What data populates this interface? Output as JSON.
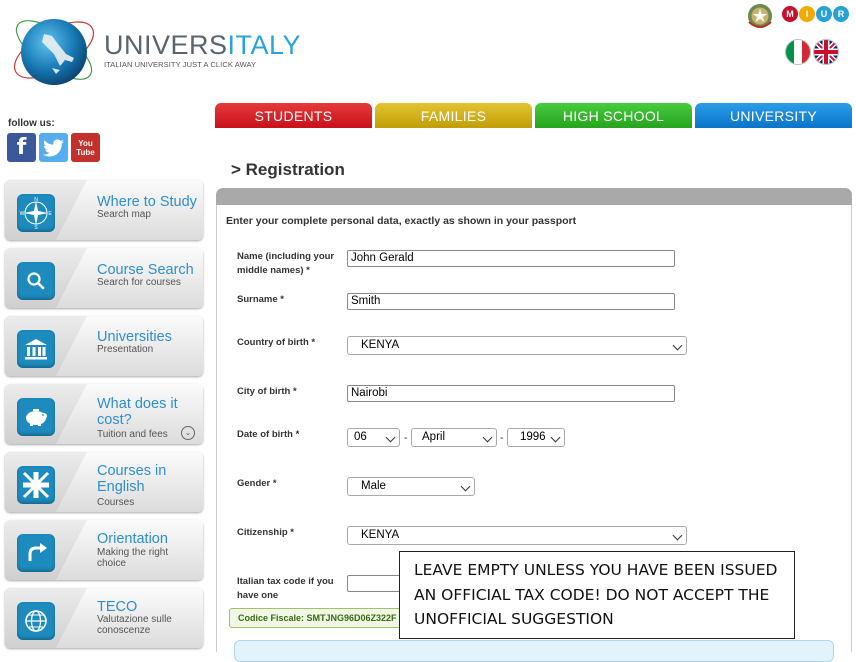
{
  "brand": {
    "name_a": "UNIVERS",
    "name_b": "ITALY",
    "tagline": "ITALIAN UNIVERSITY JUST A CLICK AWAY"
  },
  "miur_letters": [
    "M",
    "I",
    "U",
    "R"
  ],
  "follow_us": "follow us:",
  "social": {
    "youtube_top": "You",
    "youtube_bottom": "Tube"
  },
  "nav": {
    "students": "STUDENTS",
    "families": "FAMILIES",
    "high_school": "HIGH SCHOOL",
    "university": "UNIVERSITY"
  },
  "sidebar": [
    {
      "title": "Where to Study",
      "subtitle": "Search map",
      "icon": "compass-icon"
    },
    {
      "title": "Course Search",
      "subtitle": "Search for courses",
      "icon": "magnifier-icon"
    },
    {
      "title": "Universities",
      "subtitle": "Presentation",
      "icon": "institution-icon"
    },
    {
      "title": "What does it cost?",
      "subtitle": "Tuition and fees",
      "icon": "piggy-bank-icon"
    },
    {
      "title": "Courses in English",
      "subtitle": "Courses",
      "icon": "union-jack-icon"
    },
    {
      "title": "Orientation",
      "subtitle": "Making the right choice",
      "icon": "arrow-turn-icon"
    },
    {
      "title": "TECO",
      "subtitle": "Valutazione sulle conoscenze",
      "icon": "globe-icon"
    }
  ],
  "page_title": "> Registration",
  "form": {
    "intro": "Enter your complete personal data, exactly as shown in your passport",
    "name_label": "Name (including your middle names) *",
    "name_value": "John Gerald",
    "surname_label": "Surname *",
    "surname_value": "Smith",
    "country_label": "Country of birth *",
    "country_value": "KENYA",
    "city_label": "City of birth *",
    "city_value": "Nairobi",
    "dob_label": "Date of birth *",
    "dob_day": "06",
    "dob_month": "April",
    "dob_year": "1996",
    "dob_sep": "-",
    "gender_label": "Gender *",
    "gender_value": "Male",
    "citizenship_label": "Citizenship *",
    "citizenship_value": "KENYA",
    "taxcode_label": "Italian tax code if you have one",
    "taxcode_value": "",
    "fiscal_suggestion": "Codice Fiscale: SMTJNG96D06Z322F"
  },
  "callout": "LEAVE EMPTY UNLESS YOU HAVE BEEN ISSUED AN OFFICIAL TAX CODE! DO NOT ACCEPT THE UNOFFICIAL SUGGESTION",
  "colors": {
    "students": "#d42227",
    "families": "#d2b01c",
    "high_school": "#36b62d",
    "university": "#1a88da",
    "link": "#2d8fcd",
    "sidebar_icon": "#1d8bbd"
  }
}
